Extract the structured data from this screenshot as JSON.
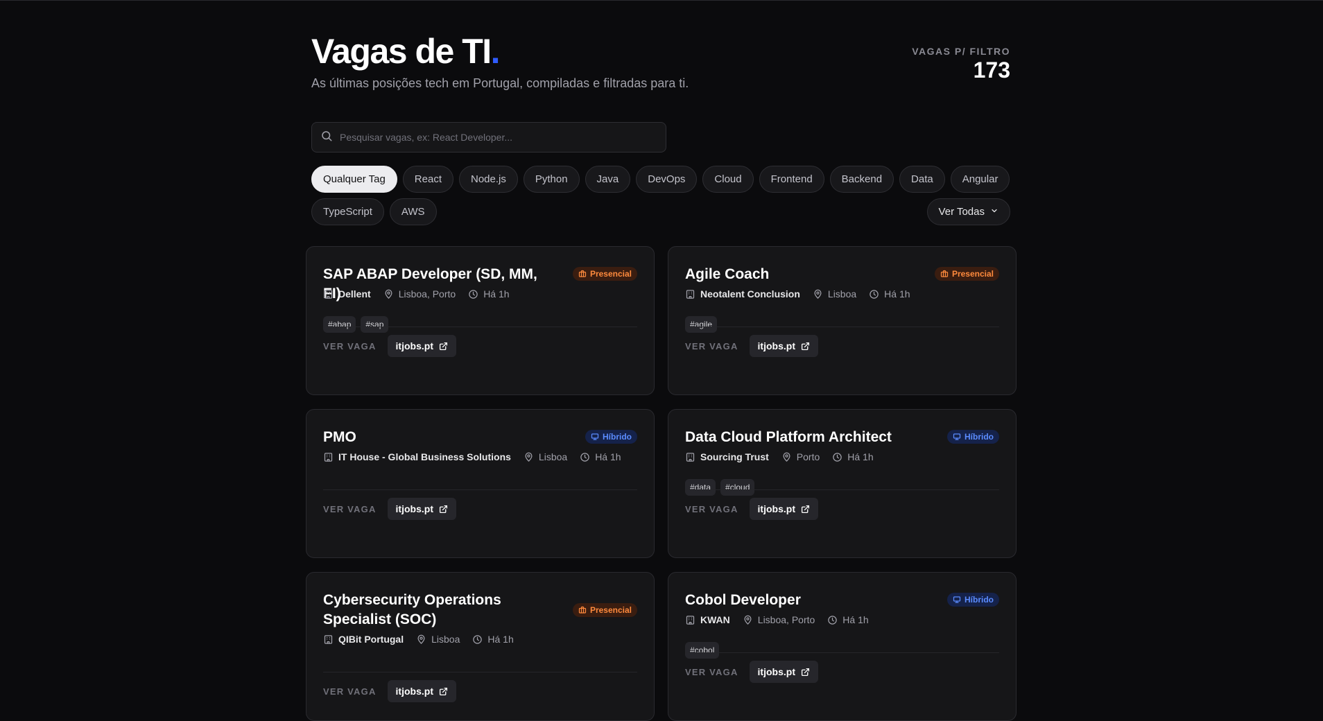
{
  "header": {
    "title": "Vagas de TI",
    "title_dot": ".",
    "subtitle": "As últimas posições tech em Portugal, compiladas e filtradas para ti.",
    "counter_label": "VAGAS P/ FILTRO",
    "counter_value": "173"
  },
  "search": {
    "placeholder": "Pesquisar vagas, ex: React Developer...",
    "value": ""
  },
  "tags": [
    "Qualquer Tag",
    "React",
    "Node.js",
    "Python",
    "Java",
    "DevOps",
    "Cloud",
    "Frontend",
    "Backend",
    "Data",
    "Angular",
    "TypeScript",
    "AWS"
  ],
  "active_tag": "Qualquer Tag",
  "ver_todas_label": "Ver Todas",
  "footer_label": "VER VAGA",
  "colors": {
    "accent": "#2f5cff",
    "presencial": "#ff8a3d",
    "hibrido": "#5b8cff"
  },
  "jobs": [
    {
      "title": "SAP ABAP Developer (SD, MM, FI)",
      "mode": "Presencial",
      "company": "Dellent",
      "location": "Lisboa, Porto",
      "time": "Há 1h",
      "tags": [
        "#abap",
        "#sap"
      ],
      "source": "itjobs.pt"
    },
    {
      "title": "Agile Coach",
      "mode": "Presencial",
      "company": "Neotalent Conclusion",
      "location": "Lisboa",
      "time": "Há 1h",
      "tags": [
        "#agile"
      ],
      "source": "itjobs.pt"
    },
    {
      "title": "PMO",
      "mode": "Híbrido",
      "company": "IT House - Global Business Solutions",
      "location": "Lisboa",
      "time": "Há 1h",
      "tags": [],
      "source": "itjobs.pt"
    },
    {
      "title": "Data Cloud Platform Architect",
      "mode": "Híbrido",
      "company": "Sourcing Trust",
      "location": "Porto",
      "time": "Há 1h",
      "tags": [
        "#data",
        "#cloud"
      ],
      "source": "itjobs.pt"
    },
    {
      "title": "Cybersecurity Operations Specialist (SOC)",
      "mode": "Presencial",
      "company": "QIBit Portugal",
      "location": "Lisboa",
      "time": "Há 1h",
      "tags": [],
      "source": "itjobs.pt"
    },
    {
      "title": "Cobol Developer",
      "mode": "Híbrido",
      "company": "KWAN",
      "location": "Lisboa, Porto",
      "time": "Há 1h",
      "tags": [
        "#cobol"
      ],
      "source": "itjobs.pt"
    }
  ]
}
